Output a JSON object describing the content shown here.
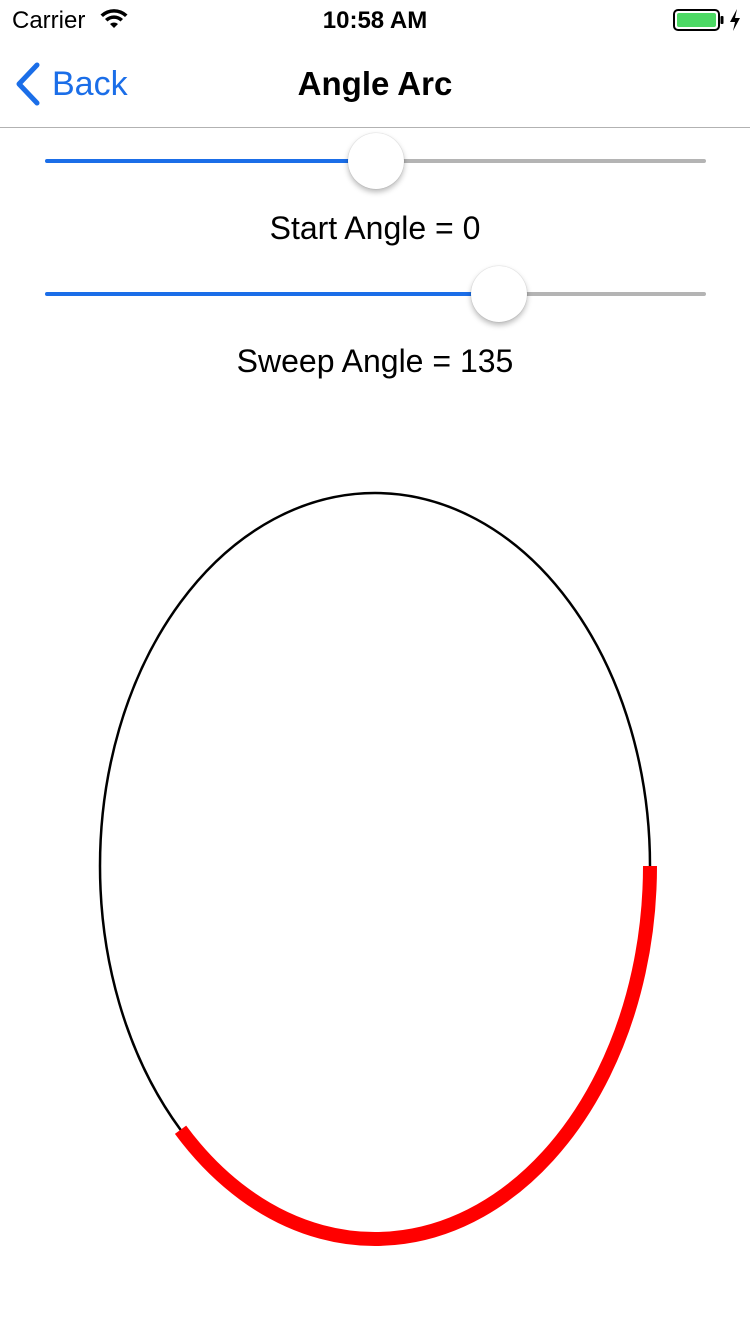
{
  "status_bar": {
    "carrier": "Carrier",
    "time": "10:58 AM",
    "wifi_icon": "wifi-icon",
    "battery_icon": "battery-charging-icon"
  },
  "nav": {
    "back_label": "Back",
    "title": "Angle Arc",
    "back_icon": "chevron-left-icon"
  },
  "colors": {
    "accent": "#1b6ee8",
    "arc": "#ff0000",
    "ellipse": "#000000",
    "battery": "#4cd964"
  },
  "sliders": [
    {
      "name": "start-angle",
      "label": "Start Angle = 0",
      "fraction": 0.5
    },
    {
      "name": "sweep-angle",
      "label": "Sweep Angle = 135",
      "fraction": 0.6875
    }
  ],
  "arc": {
    "start_angle": 0,
    "sweep_angle": 135
  }
}
